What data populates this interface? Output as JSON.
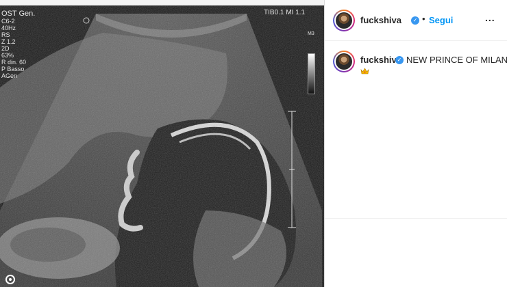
{
  "post": {
    "ultrasound": {
      "params": [
        "OST Gen.",
        "C6-2",
        "40Hz",
        "RS",
        "Z 1.2",
        "2D",
        "63%",
        "R din. 60",
        "P Basso",
        "AGen"
      ],
      "top_right": "TIB0.1  MI 1.1",
      "grayscale_label": "M3"
    }
  },
  "header": {
    "username": "fuckshiva",
    "verified_icon": "verified-badge-icon",
    "separator": "•",
    "follow_label": "Segui",
    "more_icon": "..."
  },
  "caption": {
    "username": "fuckshiva",
    "text": "NEW PRINCE OF MILAN",
    "emoji": "crown-icon"
  },
  "colors": {
    "follow_blue": "#0095f6",
    "verified_blue": "#3897f0",
    "text": "#262626"
  }
}
